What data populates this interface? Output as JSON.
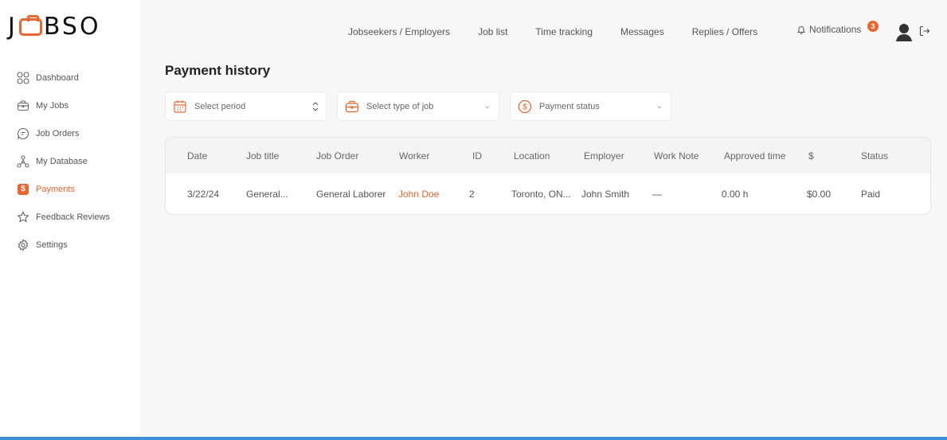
{
  "app": {
    "logo_text_left": "J",
    "logo_text_right": "BSO",
    "accent_color": "#e8662f"
  },
  "sidebar": {
    "items": [
      {
        "label": "Dashboard",
        "icon": "grid-icon",
        "active": false
      },
      {
        "label": "My Jobs",
        "icon": "briefcase-icon",
        "active": false
      },
      {
        "label": "Job Orders",
        "icon": "chat-icon",
        "active": false
      },
      {
        "label": "My Database",
        "icon": "network-icon",
        "active": false
      },
      {
        "label": "Payments",
        "icon": "dollar-icon",
        "active": true
      },
      {
        "label": "Feedback Reviews",
        "icon": "star-icon",
        "active": false
      },
      {
        "label": "Settings",
        "icon": "gear-icon",
        "active": false
      }
    ]
  },
  "topnav": {
    "links": [
      "Jobseekers / Employers",
      "Job list",
      "Time tracking",
      "Messages",
      "Replies / Offers"
    ],
    "notifications_label": "Notifications",
    "notifications_count": "3"
  },
  "main": {
    "title": "Payment history",
    "filters": {
      "period_placeholder": "Select period",
      "job_type_placeholder": "Select type of job",
      "payment_status_placeholder": "Payment status"
    },
    "table": {
      "columns": [
        "Date",
        "Job title",
        "Job Order",
        "Worker",
        "ID",
        "Location",
        "Employer",
        "Work Note",
        "Approved time",
        "$",
        "Status"
      ],
      "rows": [
        {
          "date": "3/22/24",
          "job_title": "General...",
          "job_order": "General Laborer",
          "worker": "John Doe",
          "id": "2",
          "location": "Toronto, ON...",
          "employer": "John Smith",
          "work_note": "—",
          "approved_time": "0.00 h",
          "amount": "$0.00",
          "status": "Paid"
        }
      ]
    }
  }
}
